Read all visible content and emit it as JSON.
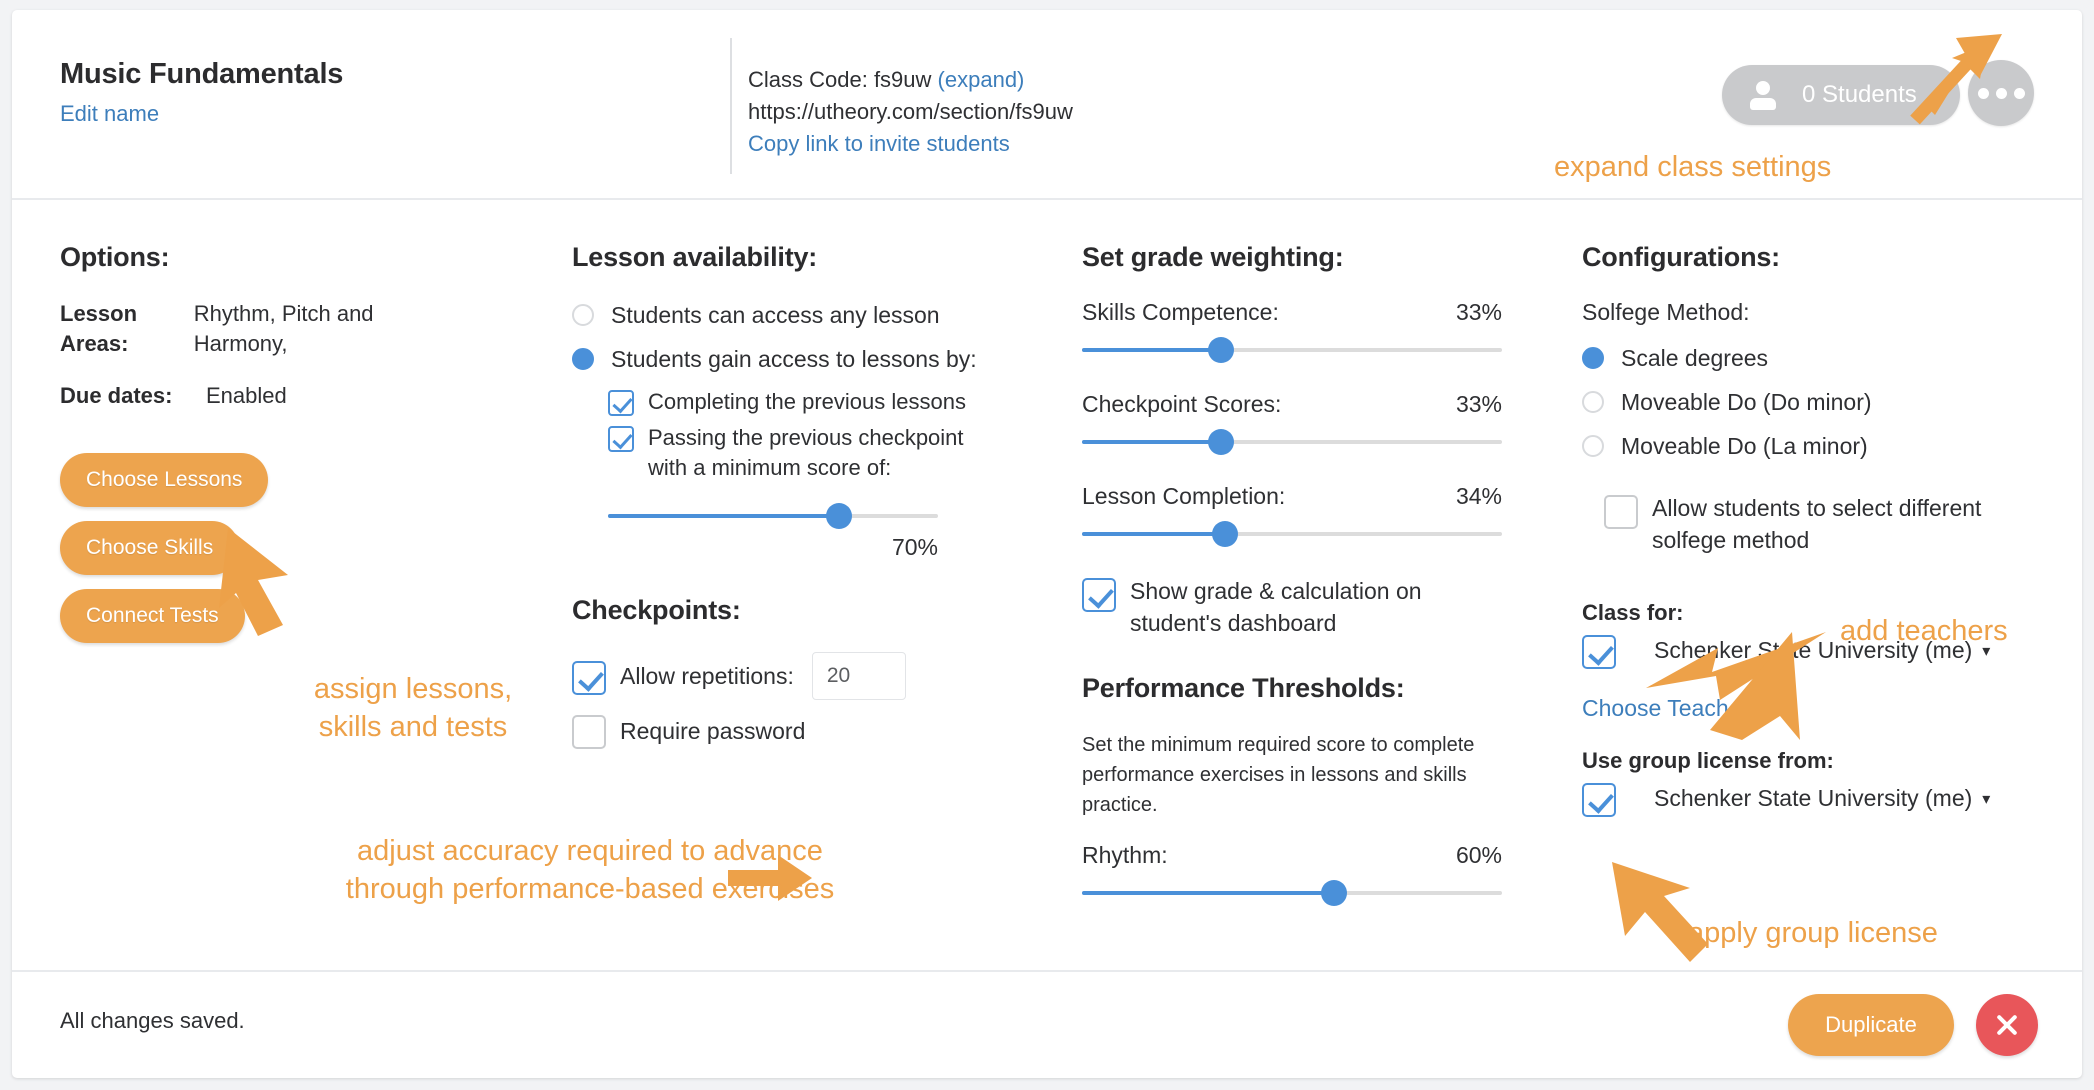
{
  "header": {
    "class_title": "Music Fundamentals",
    "edit_name": "Edit name",
    "class_code_label": "Class Code: fs9uw",
    "expand_link": "(expand)",
    "class_url": "https://utheory.com/section/fs9uw",
    "copy_link": "Copy link to invite students",
    "students_count_label": "0 Students",
    "person_icon": "person-icon",
    "more_icon": "ellipsis-icon"
  },
  "options": {
    "heading": "Options:",
    "rows": [
      {
        "key": "Lesson Areas:",
        "value": "Rhythm, Pitch and Harmony,"
      },
      {
        "key": "Due dates:",
        "value": "Enabled"
      }
    ],
    "buttons": [
      "Choose Lessons",
      "Choose Skills",
      "Connect Tests"
    ]
  },
  "lesson_availability": {
    "heading": "Lesson availability:",
    "radio_any": "Students can access any lesson",
    "radio_gain": "Students gain access to lessons by:",
    "radio_selected": "gain",
    "check_complete": "Completing the previous lessons",
    "check_complete_on": true,
    "check_pass": "Passing the previous checkpoint with a minimum score of:",
    "check_pass_on": true,
    "min_score_pct": 70,
    "min_score_label": "70%"
  },
  "checkpoints": {
    "heading": "Checkpoints:",
    "allow_repetitions_label": "Allow repetitions:",
    "allow_repetitions_on": true,
    "repetitions_value": "20",
    "require_password_label": "Require password",
    "require_password_on": false
  },
  "grade_weighting": {
    "heading": "Set grade weighting:",
    "items": [
      {
        "name": "Skills Competence:",
        "value": 33,
        "label": "33%"
      },
      {
        "name": "Checkpoint Scores:",
        "value": 33,
        "label": "33%"
      },
      {
        "name": "Lesson Completion:",
        "value": 34,
        "label": "34%"
      }
    ],
    "show_grade_label": "Show grade & calculation on student's dashboard",
    "show_grade_on": true
  },
  "performance_thresholds": {
    "heading": "Performance Thresholds:",
    "description": "Set the minimum required score to complete performance exercises in lessons and skills practice.",
    "rhythm_name": "Rhythm:",
    "rhythm_value": 60,
    "rhythm_label": "60%"
  },
  "configurations": {
    "heading": "Configurations:",
    "solfege_label": "Solfege Method:",
    "solfege_options": [
      {
        "label": "Scale degrees",
        "selected": true
      },
      {
        "label": "Moveable Do (Do minor)",
        "selected": false
      },
      {
        "label": "Moveable Do (La minor)",
        "selected": false
      }
    ],
    "allow_select_label": "Allow students to select different solfege method",
    "allow_select_on": false,
    "class_for_label": "Class for:",
    "class_for_value": "Schenker State University (me)",
    "class_for_on": true,
    "choose_teachers": "Choose Teachers",
    "group_license_label": "Use group license from:",
    "group_license_value": "Schenker State University (me)",
    "group_license_on": true,
    "caret_icon": "chevron-down-icon"
  },
  "footer": {
    "saved_text": "All changes saved.",
    "duplicate_label": "Duplicate",
    "close_icon": "close-icon"
  },
  "annotations": [
    {
      "text": "expand class settings",
      "name": "annotation-expand-class-settings"
    },
    {
      "text": "assign lessons,\nskills and tests",
      "name": "annotation-assign-lessons"
    },
    {
      "text": "adjust accuracy required to advance\nthrough performance-based exercises",
      "name": "annotation-adjust-accuracy"
    },
    {
      "text": "add teachers",
      "name": "annotation-add-teachers"
    },
    {
      "text": "apply group license",
      "name": "annotation-apply-group-license"
    }
  ],
  "colors": {
    "accent_orange": "#eda44e",
    "annotation_orange": "#eda149",
    "link_blue": "#3d7ebb",
    "slider_blue": "#4a90d9",
    "danger_red": "#e8565a"
  }
}
